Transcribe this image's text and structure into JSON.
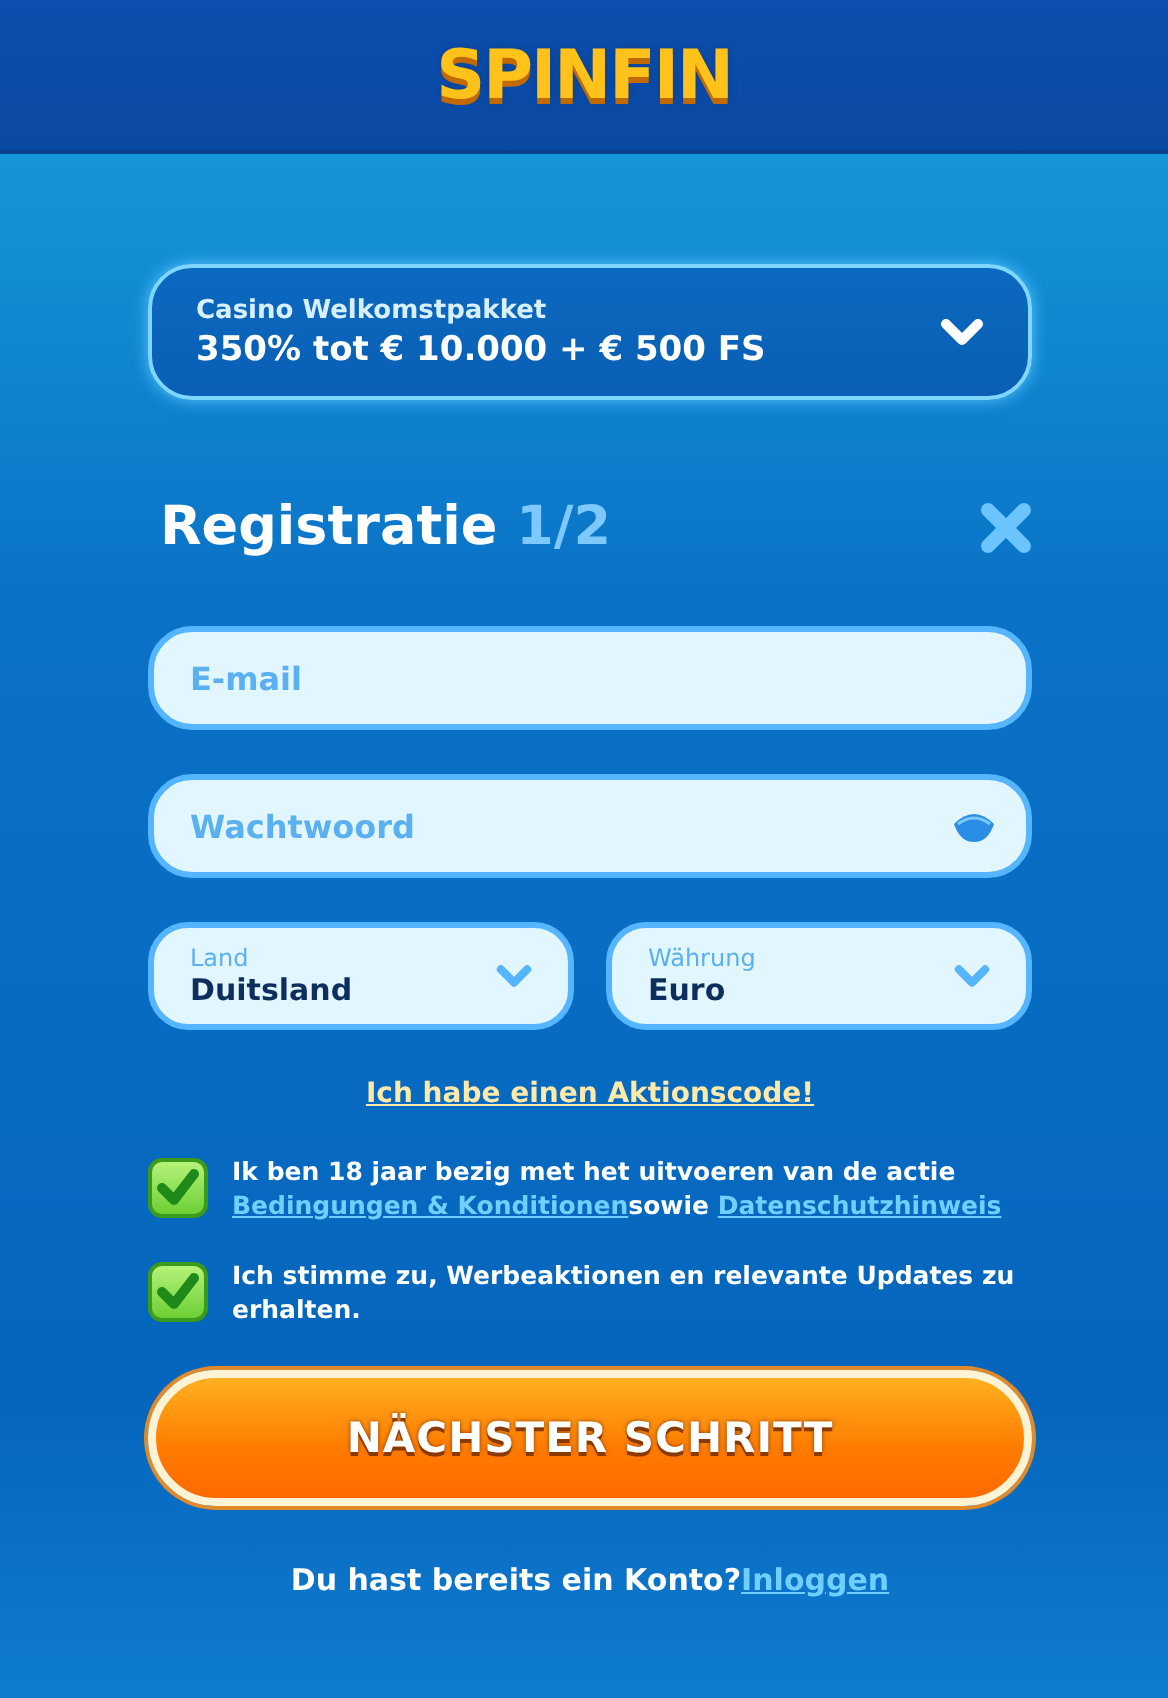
{
  "header": {
    "logo": "SPINFIN"
  },
  "promo": {
    "label": "Casino Welkomstpakket",
    "value": "350% tot € 10.000 + € 500 FS"
  },
  "title": {
    "text": "Registratie",
    "step": "1/2"
  },
  "fields": [
    {
      "placeholder": "E-mail",
      "kind": "text"
    },
    {
      "placeholder": "Wachtwoord",
      "kind": "password"
    }
  ],
  "selects": [
    {
      "label": "Land",
      "value": "Duitsland"
    },
    {
      "label": "Währung",
      "value": "Euro"
    }
  ],
  "promo_code_link": "Ich habe einen Aktionscode!",
  "consents": [
    {
      "checked": true,
      "parts": [
        {
          "kind": "text",
          "text": "Ik ben 18 jaar bezig met het uitvoeren van de actie "
        },
        {
          "kind": "link",
          "text": "Bedingungen & Konditionen"
        },
        {
          "kind": "text",
          "text": "sowie "
        },
        {
          "kind": "link",
          "text": "Datenschutzhinweis"
        }
      ]
    },
    {
      "checked": true,
      "parts": [
        {
          "kind": "text",
          "text": "Ich stimme zu, Werbeaktionen en relevante Updates zu erhalten."
        }
      ]
    }
  ],
  "submit": "NÄCHSTER SCHRITT",
  "footer": {
    "text": "Du hast bereits ein Konto?",
    "link": "Inloggen"
  }
}
